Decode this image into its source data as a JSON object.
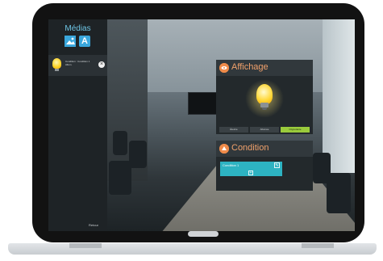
{
  "colors": {
    "accent_blue": "#3aa7dc",
    "accent_orange": "#ef8b4a",
    "accent_green": "#9acb3c",
    "accent_teal": "#2db3c2"
  },
  "sidebar": {
    "title": "Médias",
    "tool_image_icon": "image-icon",
    "tool_text_icon": "text-icon",
    "tool_text_glyph": "A",
    "item": {
      "icon": "lightbulb-icon",
      "line1": "Condition : Condition 1",
      "line2": "Allum.",
      "close_glyph": "×"
    },
    "footer": "Retour"
  },
  "affichage": {
    "title": "Affichage",
    "buttons": [
      "Éteinte",
      "Allumée",
      "Clignotante"
    ],
    "active_button": "Clignotante"
  },
  "condition": {
    "title": "Condition",
    "rows": [
      {
        "label": "Condition 1"
      }
    ],
    "edit_icon": "edit-icon",
    "add_icon": "add-icon"
  }
}
